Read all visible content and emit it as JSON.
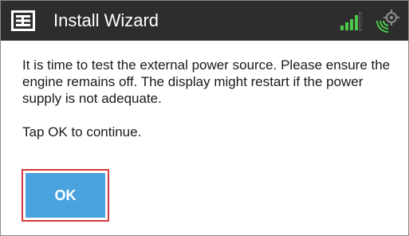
{
  "window": {
    "title": "Install Wizard",
    "logo_icon": "app-logo-icon",
    "status_icons": [
      "signal-strength-icon",
      "gps-icon"
    ]
  },
  "message": {
    "body": "It is time to test the external power source. Please ensure the engine remains off. The display might restart if the power supply is not adequate.",
    "instruction": "Tap OK to continue."
  },
  "actions": {
    "ok_label": "OK"
  },
  "colors": {
    "titlebar": "#2d2d2d",
    "accent_button": "#4aa3df",
    "highlight_outline": "#d63a3a",
    "signal_green": "#4cc94a",
    "signal_dim": "#6a6a6a"
  }
}
